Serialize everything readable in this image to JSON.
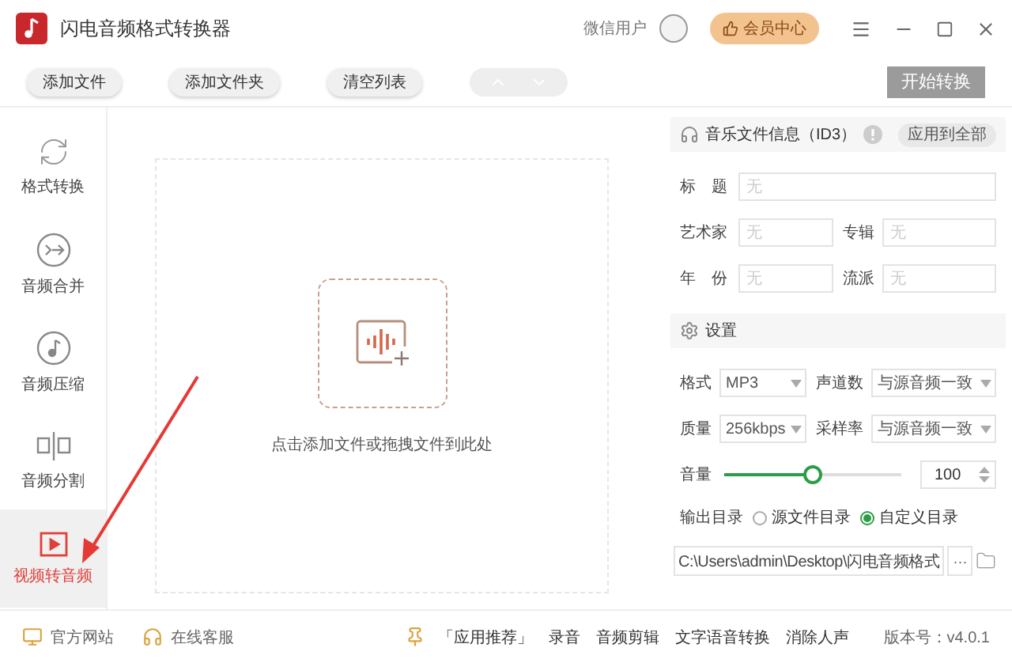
{
  "window": {
    "title": "闪电音频格式转换器",
    "user": "微信用户",
    "vip_button": "会员中心"
  },
  "toolbar": {
    "buttons": [
      "添加文件",
      "添加文件夹",
      "清空列表"
    ],
    "start_button": {
      "label": "开始转换",
      "disabled": true
    }
  },
  "sidebar": {
    "items": [
      {
        "label": "格式转换",
        "kind": "convert",
        "selected": false
      },
      {
        "label": "音频合并",
        "kind": "merge",
        "selected": false
      },
      {
        "label": "音频压缩",
        "kind": "compress",
        "selected": false
      },
      {
        "label": "音频分割",
        "kind": "split",
        "selected": false
      },
      {
        "label": "视频转音频",
        "kind": "video",
        "selected": true
      }
    ]
  },
  "drop_zone": {
    "hint": "点击添加文件或拖拽文件到此处"
  },
  "id3": {
    "title": "音乐文件信息（ID3）",
    "apply_button": "应用到全部",
    "rows": [
      [
        {
          "label": "标　题",
          "placeholder": "无"
        }
      ],
      [
        {
          "label": "艺术家",
          "placeholder": "无"
        },
        {
          "label": "专辑",
          "placeholder": "无"
        }
      ],
      [
        {
          "label": "年　份",
          "placeholder": "无"
        },
        {
          "label": "流派",
          "placeholder": "无"
        }
      ]
    ]
  },
  "settings": {
    "title": "设置",
    "rows": [
      [
        {
          "label": "格式",
          "value": "MP3"
        },
        {
          "label": "声道数",
          "value": "与源音频一致"
        }
      ],
      [
        {
          "label": "质量",
          "value": "256kbps"
        },
        {
          "label": "采样率",
          "value": "与源音频一致"
        }
      ]
    ],
    "volume": {
      "label": "音量",
      "level": 0.5,
      "value": "100"
    },
    "output": {
      "label": "输出目录",
      "options": [
        {
          "label": "源文件目录",
          "selected": false
        },
        {
          "label": "自定义目录",
          "selected": true
        }
      ],
      "path": "C:\\Users\\admin\\Desktop\\闪电音频格式",
      "more_button": "···"
    }
  },
  "footer": {
    "links": [
      {
        "label": "官方网站",
        "kind": "monitor"
      },
      {
        "label": "在线客服",
        "kind": "headset"
      }
    ],
    "recommend": "「应用推荐」",
    "apps": [
      "录音",
      "音频剪辑",
      "文字语音转换",
      "消除人声"
    ],
    "version": "版本号：v4.0.1"
  }
}
